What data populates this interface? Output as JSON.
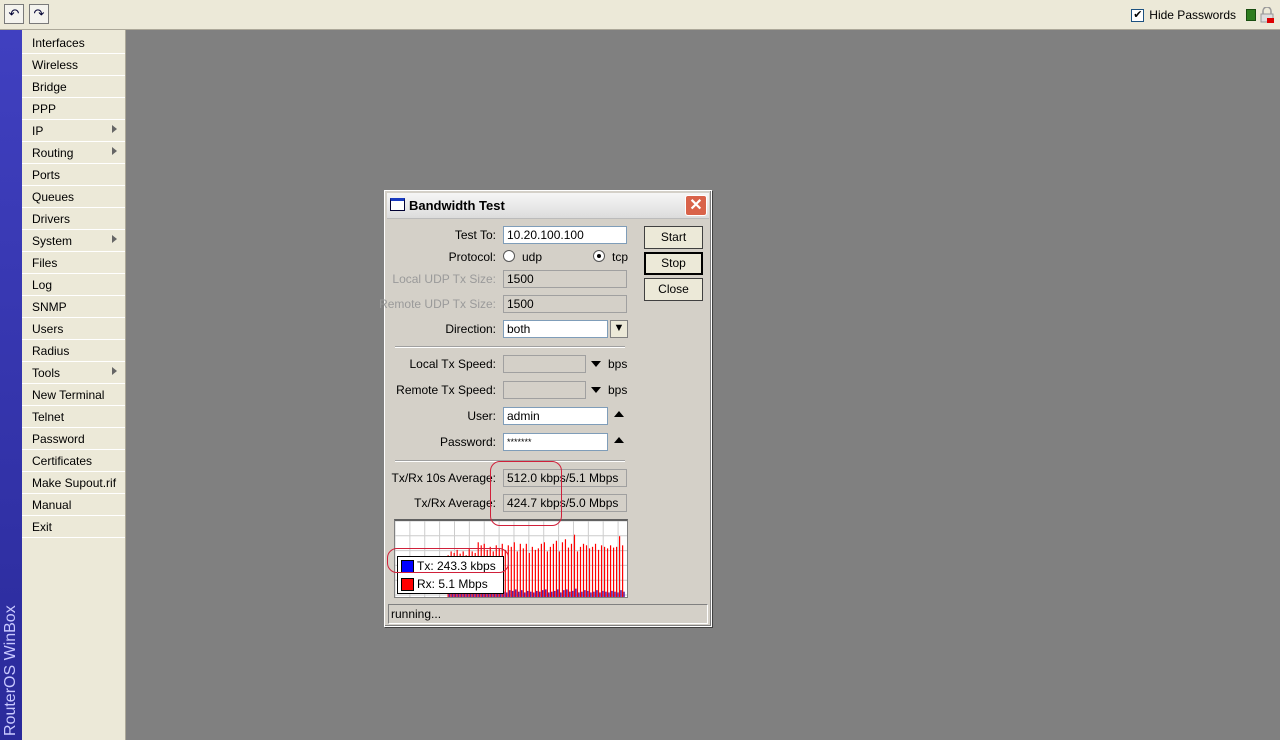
{
  "toolbar": {
    "undo_icon": "undo-icon",
    "redo_icon": "redo-icon",
    "hide_passwords_label": "Hide Passwords",
    "hide_passwords_checked": true
  },
  "brand": "RouterOS WinBox",
  "menu": [
    {
      "label": "Interfaces"
    },
    {
      "label": "Wireless"
    },
    {
      "label": "Bridge"
    },
    {
      "label": "PPP"
    },
    {
      "label": "IP",
      "submenu": true
    },
    {
      "label": "Routing",
      "submenu": true
    },
    {
      "label": "Ports"
    },
    {
      "label": "Queues"
    },
    {
      "label": "Drivers"
    },
    {
      "label": "System",
      "submenu": true
    },
    {
      "label": "Files"
    },
    {
      "label": "Log"
    },
    {
      "label": "SNMP"
    },
    {
      "label": "Users"
    },
    {
      "label": "Radius"
    },
    {
      "label": "Tools",
      "submenu": true
    },
    {
      "label": "New Terminal"
    },
    {
      "label": "Telnet"
    },
    {
      "label": "Password"
    },
    {
      "label": "Certificates"
    },
    {
      "label": "Make Supout.rif"
    },
    {
      "label": "Manual"
    },
    {
      "label": "Exit"
    }
  ],
  "dialog": {
    "title": "Bandwidth Test",
    "test_to_label": "Test To:",
    "test_to": "10.20.100.100",
    "protocol_label": "Protocol:",
    "udp": "udp",
    "tcp": "tcp",
    "protocol_selected": "tcp",
    "local_udp_label": "Local UDP Tx Size:",
    "local_udp": "1500",
    "remote_udp_label": "Remote UDP Tx Size:",
    "remote_udp": "1500",
    "direction_label": "Direction:",
    "direction": "both",
    "local_tx_label": "Local Tx Speed:",
    "local_tx": "",
    "remote_tx_label": "Remote Tx Speed:",
    "remote_tx": "",
    "bps": "bps",
    "user_label": "User:",
    "user": "admin",
    "password_label": "Password:",
    "password": "*******",
    "avg10_label": "Tx/Rx 10s Average:",
    "avg10": "512.0 kbps/5.1 Mbps",
    "avg_label": "Tx/Rx Average:",
    "avg": "424.7 kbps/5.0 Mbps",
    "start": "Start",
    "stop": "Stop",
    "close": "Close",
    "legend_tx": "Tx:  243.3 kbps",
    "legend_rx": "Rx:  5.1 Mbps",
    "tx_color": "#0000ff",
    "rx_color": "#ff0000",
    "status": "running..."
  },
  "graph": {
    "rx": [
      0.55,
      0.6,
      0.58,
      0.62,
      0.57,
      0.6,
      0.55,
      0.63,
      0.6,
      0.58,
      0.72,
      0.68,
      0.7,
      0.62,
      0.66,
      0.6,
      0.68,
      0.64,
      0.7,
      0.62,
      0.68,
      0.66,
      0.72,
      0.6,
      0.7,
      0.64,
      0.7,
      0.58,
      0.66,
      0.62,
      0.64,
      0.7,
      0.72,
      0.6,
      0.66,
      0.7,
      0.74,
      0.6,
      0.72,
      0.76,
      0.65,
      0.7,
      0.82,
      0.6,
      0.66,
      0.7,
      0.68,
      0.64,
      0.66,
      0.7,
      0.62,
      0.68,
      0.66,
      0.64,
      0.68,
      0.65,
      0.66,
      0.8,
      0.68
    ],
    "tx": [
      0.06,
      0.07,
      0.05,
      0.08,
      0.06,
      0.07,
      0.05,
      0.09,
      0.06,
      0.07,
      0.12,
      0.08,
      0.1,
      0.07,
      0.09,
      0.06,
      0.1,
      0.08,
      0.07,
      0.06,
      0.09,
      0.08,
      0.1,
      0.07,
      0.09,
      0.06,
      0.08,
      0.07,
      0.06,
      0.08,
      0.07,
      0.09,
      0.1,
      0.06,
      0.07,
      0.08,
      0.1,
      0.06,
      0.09,
      0.1,
      0.07,
      0.08,
      0.11,
      0.06,
      0.07,
      0.09,
      0.08,
      0.06,
      0.07,
      0.09,
      0.06,
      0.08,
      0.07,
      0.06,
      0.08,
      0.07,
      0.06,
      0.09,
      0.07
    ]
  }
}
